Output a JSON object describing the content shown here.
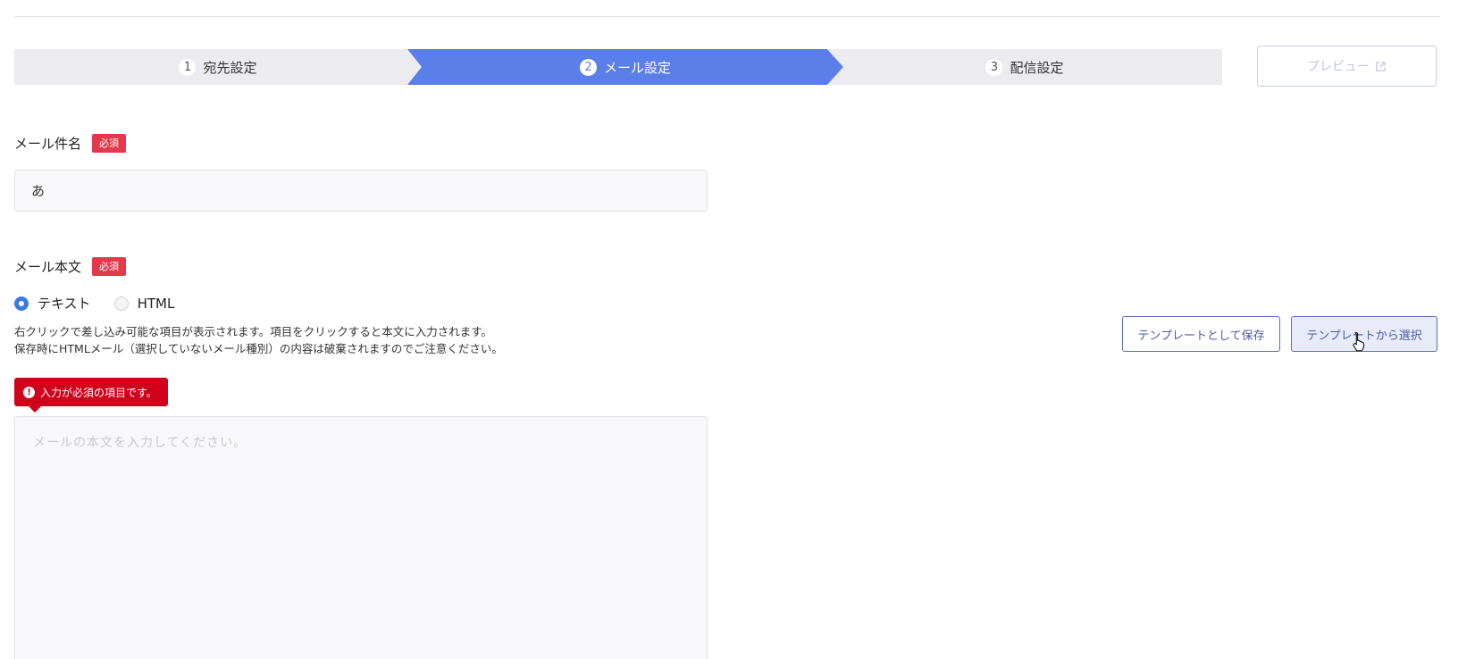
{
  "stepper": {
    "steps": [
      {
        "number": "1",
        "label": "宛先設定"
      },
      {
        "number": "2",
        "label": "メール設定"
      },
      {
        "number": "3",
        "label": "配信設定"
      }
    ],
    "active_step": 2,
    "preview_label": "プレビュー"
  },
  "subject": {
    "label": "メール件名",
    "required_badge": "必須",
    "value": "あ"
  },
  "body": {
    "label": "メール本文",
    "required_badge": "必須",
    "format_options": [
      "テキスト",
      "HTML"
    ],
    "selected_format": "テキスト",
    "help_line1": "右クリックで差し込み可能な項目が表示されます。項目をクリックすると本文に入力されます。",
    "help_line2": "保存時にHTMLメール（選択していないメール種別）の内容は破棄されますのでご注意ください。",
    "error_message": "入力が必須の項目です。",
    "placeholder": "メールの本文を入力してください。"
  },
  "template_buttons": {
    "save_label": "テンプレートとして保存",
    "select_label": "テンプレートから選択"
  },
  "colors": {
    "active_step": "#5b7fe8",
    "required_badge": "#e23a4a",
    "error": "#d0021b",
    "radio_checked": "#3b7be0"
  },
  "icons": {
    "preview": "external-link-icon",
    "error": "exclamation-circle-icon",
    "cursor": "hand-pointer-icon"
  }
}
